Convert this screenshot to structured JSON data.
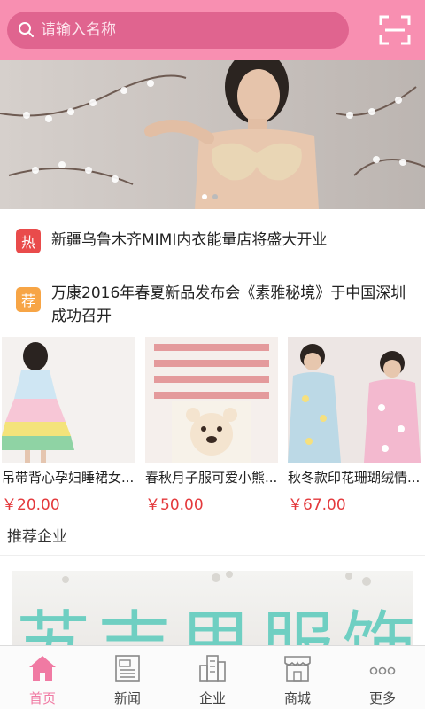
{
  "search": {
    "placeholder": "请输入名称"
  },
  "icons": {
    "search": "search-icon",
    "scan": "scan-icon"
  },
  "colors": {
    "brand": "#f88fb1",
    "search_bg": "#e0648f",
    "price": "#e4393c",
    "hot_badge": "#e94b4b",
    "rec_badge": "#f7a546"
  },
  "banner": {
    "dots": 2,
    "active_dot": 0
  },
  "news": [
    {
      "badge": "热",
      "text": "新疆乌鲁木齐MIMI内衣能量店将盛大开业"
    },
    {
      "badge": "荐",
      "text": "万康2016年春夏新品发布会《素雅秘境》于中国深圳成功召开"
    }
  ],
  "products": [
    {
      "name": "吊带背心孕妇睡裙女...",
      "price": "￥20.00"
    },
    {
      "name": "春秋月子服可爱小熊...",
      "price": "￥50.00"
    },
    {
      "name": "秋冬款印花珊瑚绒情...",
      "price": "￥67.00"
    }
  ],
  "section": {
    "title": "推荐企业"
  },
  "company": {
    "banner_text": "苏吉思服饰"
  },
  "tabbar": [
    {
      "label": "首页",
      "icon": "home-icon",
      "active": true
    },
    {
      "label": "新闻",
      "icon": "news-icon",
      "active": false
    },
    {
      "label": "企业",
      "icon": "building-icon",
      "active": false
    },
    {
      "label": "商城",
      "icon": "shop-icon",
      "active": false
    },
    {
      "label": "更多",
      "icon": "more-icon",
      "active": false
    }
  ]
}
